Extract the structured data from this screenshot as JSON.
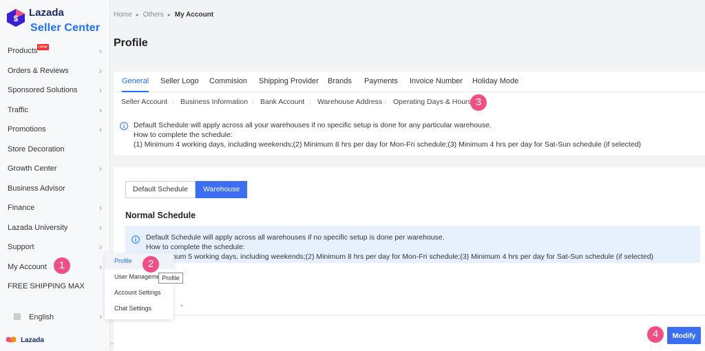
{
  "app": {
    "brand": "Lazada",
    "product": "Seller Center",
    "footer_brand": "Lazada"
  },
  "sidebar": {
    "new_tag": "new",
    "items": [
      {
        "label": "Products"
      },
      {
        "label": "Orders & Reviews"
      },
      {
        "label": "Sponsored Solutions"
      },
      {
        "label": "Traffic"
      },
      {
        "label": "Promotions"
      },
      {
        "label": "Store Decoration"
      },
      {
        "label": "Growth Center"
      },
      {
        "label": "Business Advisor"
      },
      {
        "label": "Finance"
      },
      {
        "label": "Lazada University"
      },
      {
        "label": "Support"
      },
      {
        "label": "My Account"
      },
      {
        "label": "FREE SHIPPING MAX"
      }
    ],
    "language": "English"
  },
  "submenu": {
    "items": [
      "Profile",
      "User Management",
      "Account Settings",
      "Chat Settings"
    ],
    "tooltip": "Profile"
  },
  "steps": [
    "1",
    "2",
    "3",
    "4"
  ],
  "breadcrumb": {
    "home": "Home",
    "others": "Others",
    "current": "My Account"
  },
  "page_title": "Profile",
  "tabs": [
    "General",
    "Seller Logo",
    "Commision",
    "Shipping Provider",
    "Brands",
    "Payments",
    "Invoice Number",
    "Holiday Mode"
  ],
  "subtabs": [
    "Seller Account",
    "Business Information",
    "Bank Account",
    "Warehouse Address",
    "Operating Days & Hours"
  ],
  "info_top": {
    "line1": "Default Schedule will apply across all your warehouses if no specific setup is done for any particular warehouse.",
    "line2": "How to complete the schedule:",
    "line3": "(1) Minimum 4 working days, including weekends;(2) Minimum 8 hrs per day for Mon-Fri schedule;(3) Minimum 4 hrs per day for Sat-Sun schedule (if selected)"
  },
  "segment": {
    "default": "Default Schedule",
    "warehouse": "Warehouse"
  },
  "normal_schedule": {
    "title": "Normal Schedule",
    "line1": "Default Schedule will apply across all warehouses if no specific setup is done per warehouse.",
    "line2": "How to complete the schedule:",
    "line3": "(1) Minimum 5 working days, including weekends;(2) Minimum 8 hrs per day for Mon-Fri schedule;(3) Minimum 4 hrs per day for Sat-Sun schedule (if selected)"
  },
  "dash": "-",
  "modify_label": "Modify",
  "colors": {
    "accent": "#1a71ff",
    "button": "#3b6ef0",
    "step_badge": "#f24e86",
    "info_bg": "#e7f1fd"
  }
}
